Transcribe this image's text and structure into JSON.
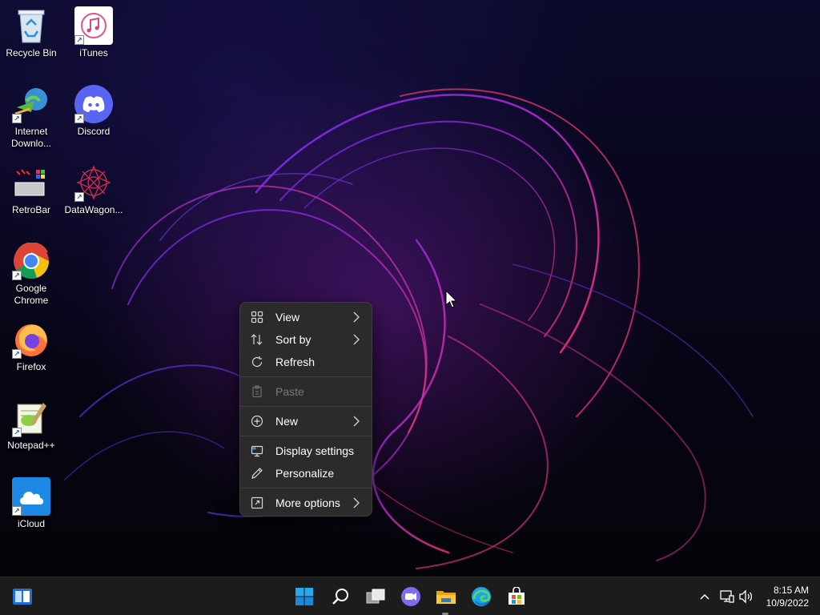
{
  "desktop": {
    "icons": [
      {
        "label": "Recycle Bin"
      },
      {
        "label": "iTunes"
      },
      {
        "label": "Internet Downlo..."
      },
      {
        "label": "Discord"
      },
      {
        "label": "RetroBar"
      },
      {
        "label": "DataWagon..."
      },
      {
        "label": "Google Chrome"
      },
      {
        "label": "Firefox"
      },
      {
        "label": "Notepad++"
      },
      {
        "label": "iCloud"
      }
    ]
  },
  "context_menu": {
    "items": [
      {
        "label": "View",
        "icon": "grid-view-icon",
        "has_submenu": true
      },
      {
        "label": "Sort by",
        "icon": "sort-icon",
        "has_submenu": true
      },
      {
        "label": "Refresh",
        "icon": "refresh-icon",
        "has_submenu": false
      },
      {
        "label": "Paste",
        "icon": "paste-icon",
        "disabled": true
      },
      {
        "label": "New",
        "icon": "new-plus-icon",
        "has_submenu": true
      },
      {
        "label": "Display settings",
        "icon": "display-icon",
        "has_submenu": false
      },
      {
        "label": "Personalize",
        "icon": "pen-icon",
        "has_submenu": false
      },
      {
        "label": "More options",
        "icon": "more-options-icon",
        "has_submenu": true
      }
    ]
  },
  "taskbar": {
    "apps": [
      "retrobar-start-icon",
      "windows-start-icon",
      "search-icon",
      "task-view-icon",
      "chat-icon",
      "file-explorer-icon",
      "edge-icon",
      "store-icon"
    ],
    "tray_icons": [
      "chevron-up-icon",
      "network-icon",
      "volume-icon"
    ],
    "clock": {
      "time": "8:15 AM",
      "date": "10/9/2022"
    }
  },
  "colors": {
    "taskbar_bg": "#1c1c1c",
    "menu_bg": "#2b2b2b",
    "accent": "#0078d4"
  }
}
